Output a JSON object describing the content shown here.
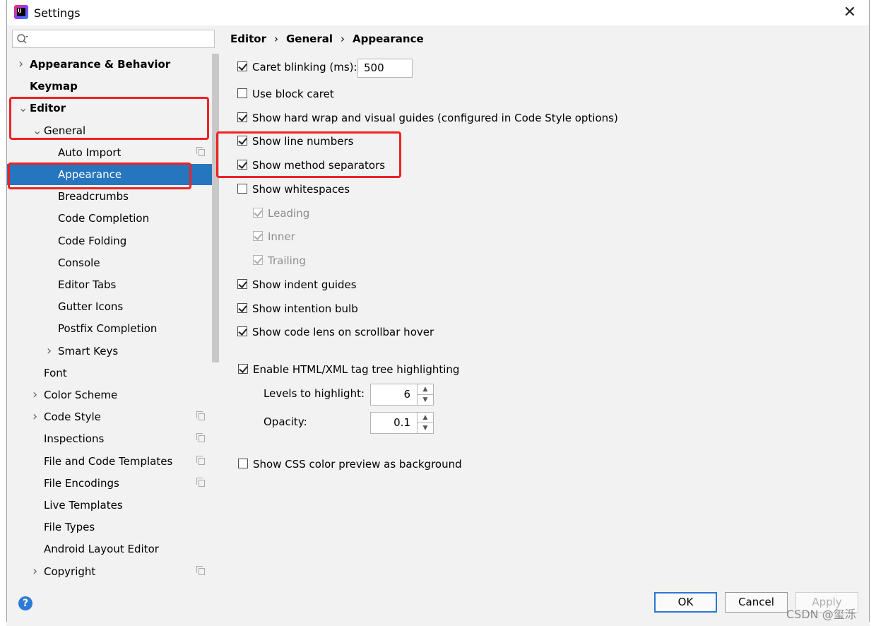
{
  "window": {
    "title": "Settings",
    "logo_text": "IJ",
    "close_glyph": "✕"
  },
  "search": {
    "placeholder": "",
    "icon": "search-icon"
  },
  "tree": {
    "items": [
      {
        "label": "Appearance & Behavior",
        "level": 0,
        "bold": true,
        "chevron": "›",
        "copy": false
      },
      {
        "label": "Keymap",
        "level": 0,
        "bold": true,
        "chevron": "",
        "copy": false
      },
      {
        "label": "Editor",
        "level": 0,
        "bold": true,
        "chevron": "⌄",
        "copy": false
      },
      {
        "label": "General",
        "level": 1,
        "bold": false,
        "chevron": "⌄",
        "copy": false
      },
      {
        "label": "Auto Import",
        "level": 2,
        "bold": false,
        "chevron": "",
        "copy": true
      },
      {
        "label": "Appearance",
        "level": 2,
        "bold": false,
        "chevron": "",
        "copy": false,
        "selected": true
      },
      {
        "label": "Breadcrumbs",
        "level": 2,
        "bold": false,
        "chevron": "",
        "copy": false
      },
      {
        "label": "Code Completion",
        "level": 2,
        "bold": false,
        "chevron": "",
        "copy": false
      },
      {
        "label": "Code Folding",
        "level": 2,
        "bold": false,
        "chevron": "",
        "copy": false
      },
      {
        "label": "Console",
        "level": 2,
        "bold": false,
        "chevron": "",
        "copy": false
      },
      {
        "label": "Editor Tabs",
        "level": 2,
        "bold": false,
        "chevron": "",
        "copy": false
      },
      {
        "label": "Gutter Icons",
        "level": 2,
        "bold": false,
        "chevron": "",
        "copy": false
      },
      {
        "label": "Postfix Completion",
        "level": 2,
        "bold": false,
        "chevron": "",
        "copy": false
      },
      {
        "label": "Smart Keys",
        "level": 2,
        "bold": false,
        "chevron": "›",
        "copy": false
      },
      {
        "label": "Font",
        "level": 1,
        "bold": false,
        "chevron": "",
        "copy": false
      },
      {
        "label": "Color Scheme",
        "level": 1,
        "bold": false,
        "chevron": "›",
        "copy": false
      },
      {
        "label": "Code Style",
        "level": 1,
        "bold": false,
        "chevron": "›",
        "copy": true
      },
      {
        "label": "Inspections",
        "level": 1,
        "bold": false,
        "chevron": "",
        "copy": true
      },
      {
        "label": "File and Code Templates",
        "level": 1,
        "bold": false,
        "chevron": "",
        "copy": true
      },
      {
        "label": "File Encodings",
        "level": 1,
        "bold": false,
        "chevron": "",
        "copy": true
      },
      {
        "label": "Live Templates",
        "level": 1,
        "bold": false,
        "chevron": "",
        "copy": false
      },
      {
        "label": "File Types",
        "level": 1,
        "bold": false,
        "chevron": "",
        "copy": false
      },
      {
        "label": "Android Layout Editor",
        "level": 1,
        "bold": false,
        "chevron": "",
        "copy": false
      },
      {
        "label": "Copyright",
        "level": 1,
        "bold": false,
        "chevron": "›",
        "copy": true
      }
    ]
  },
  "breadcrumb": {
    "part1": "Editor",
    "part2": "General",
    "part3": "Appearance",
    "separator": "›"
  },
  "options": {
    "caret_blinking": {
      "label": "Caret blinking (ms):",
      "checked": true,
      "value": "500"
    },
    "block_caret": {
      "label": "Use block caret",
      "checked": false
    },
    "hard_wrap": {
      "label": "Show hard wrap and visual guides (configured in Code Style options)",
      "checked": true
    },
    "line_numbers": {
      "label": "Show line numbers",
      "checked": true
    },
    "method_separators": {
      "label": "Show method separators",
      "checked": true
    },
    "whitespaces": {
      "label": "Show whitespaces",
      "checked": false
    },
    "leading": {
      "label": "Leading",
      "checked": true,
      "disabled": true
    },
    "inner": {
      "label": "Inner",
      "checked": true,
      "disabled": true
    },
    "trailing": {
      "label": "Trailing",
      "checked": true,
      "disabled": true
    },
    "indent_guides": {
      "label": "Show indent guides",
      "checked": true
    },
    "intention_bulb": {
      "label": "Show intention bulb",
      "checked": true
    },
    "code_lens": {
      "label": "Show code lens on scrollbar hover",
      "checked": true
    },
    "tag_tree": {
      "label": "Enable HTML/XML tag tree highlighting",
      "checked": true
    },
    "levels_label": "Levels to highlight:",
    "levels_value": "6",
    "opacity_label": "Opacity:",
    "opacity_value": "0.1",
    "css_preview": {
      "label": "Show CSS color preview as background",
      "checked": false
    }
  },
  "buttons": {
    "help": "?",
    "ok": "OK",
    "cancel": "Cancel",
    "apply": "Apply"
  },
  "watermark": "CSDN @玺泺",
  "colors": {
    "selection": "#2675bf",
    "highlight_box": "#f02222",
    "primary_border": "#2b78d2"
  }
}
